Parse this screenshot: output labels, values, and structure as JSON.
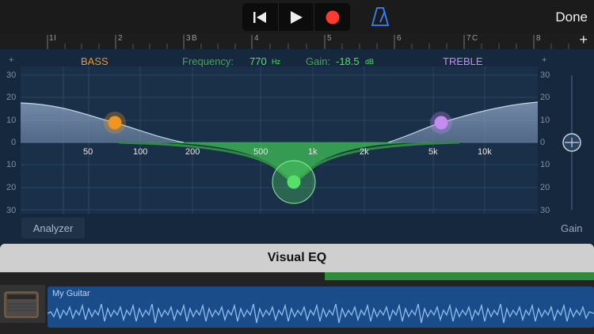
{
  "toolbar": {
    "done_label": "Done",
    "transport_icons": [
      "skip-back-icon",
      "play-icon",
      "record-icon"
    ],
    "metronome_icon": "metronome-icon",
    "record_color": "#ff3b30",
    "accent_color": "#3b82f6"
  },
  "ruler": {
    "marks": [
      "1",
      "2",
      "3",
      "4",
      "5",
      "6",
      "7",
      "8"
    ],
    "section_labels": [
      "I",
      "B",
      "C"
    ],
    "add_label": "+"
  },
  "eq": {
    "bass_label": "BASS",
    "treble_label": "TREBLE",
    "frequency_label": "Frequency:",
    "frequency_value": "770",
    "frequency_unit": "Hz",
    "gain_label": "Gain:",
    "gain_value": "-18.5",
    "gain_unit": "dB",
    "db_scale": [
      "30",
      "20",
      "10",
      "0",
      "10",
      "20",
      "30"
    ],
    "freq_labels": [
      "50",
      "100",
      "200",
      "500",
      "1k",
      "2k",
      "5k",
      "10k"
    ],
    "plus_label": "+",
    "analyzer_label": "Analyzer",
    "gain_slider_label": "Gain",
    "colors": {
      "bass": "#f0961e",
      "treble": "#c58cf0",
      "mid": "#56e06a"
    }
  },
  "panel_title": "Visual EQ",
  "tracks": {
    "region_name": "My Guitar",
    "track_icon": "amplifier-icon"
  }
}
